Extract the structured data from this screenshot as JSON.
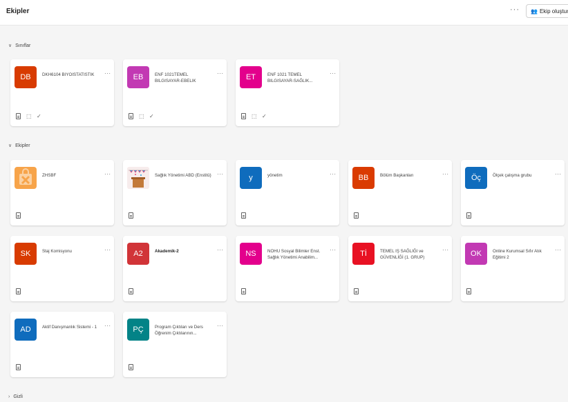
{
  "header": {
    "title": "Ekipler",
    "more": "···",
    "create_icon": "people-add-icon",
    "create_label": "Ekip oluştur v"
  },
  "sections": {
    "classes": {
      "label": "Sınıflar"
    },
    "teams": {
      "label": "Ekipler"
    },
    "hidden": {
      "label": "Gizli"
    }
  },
  "classes": [
    {
      "initials": "DB",
      "color": "#d83b01",
      "name": "DKH6104 BIYOISTATISTIK"
    },
    {
      "initials": "EB",
      "color": "#c239b3",
      "name": "ENF 1021TEMEL BILGISAYAR-EBELIK"
    },
    {
      "initials": "ET",
      "color": "#e3008c",
      "name": "ENF 1021 TEMEL BILGISAYAR-SAĞLIK..."
    }
  ],
  "teams": [
    {
      "initials": "",
      "color": "#f7a44a",
      "name": "ZHSBF",
      "image": "bag-logo"
    },
    {
      "initials": "",
      "color": "#f2d8c7",
      "name": "Sağlık Yönetimi ABD (Enstitü)",
      "image": "celebration-podium"
    },
    {
      "initials": "y",
      "color": "#0f6cbd",
      "name": "yönetim"
    },
    {
      "initials": "BB",
      "color": "#da3b01",
      "name": "Bölüm Başkanları"
    },
    {
      "initials": "Öç",
      "color": "#0f6cbd",
      "name": "Ölçek çalışma grubu"
    },
    {
      "initials": "SK",
      "color": "#d83b01",
      "name": "Staj Komisyonu"
    },
    {
      "initials": "A2",
      "color": "#d13438",
      "name": "Akademik-2",
      "bold": true
    },
    {
      "initials": "NS",
      "color": "#e3008c",
      "name": "NOHU Sosyal Bilimler Enst. Sağlık Yönetimi Anabilim..."
    },
    {
      "initials": "Tİ",
      "color": "#e81123",
      "name": "TEMEL IŞ SAĞLIĞI ve GÜVENLİĞİ (1. GRUP)"
    },
    {
      "initials": "OK",
      "color": "#c239b3",
      "name": "Online Kurumsal Sıfır Atık Eğitimi 2"
    },
    {
      "initials": "AD",
      "color": "#0f6cbd",
      "name": "Aktif Danışmanlık Sistemi - 1"
    },
    {
      "initials": "PÇ",
      "color": "#038387",
      "name": "Program Çıktıları ve Ders Öğrenim Çıktılarının..."
    }
  ],
  "more_options": "···"
}
